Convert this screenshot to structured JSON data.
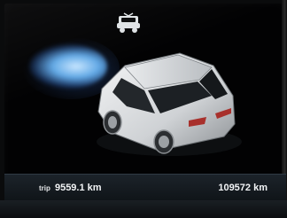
{
  "top_icon": {
    "name": "vehicle-status-icon"
  },
  "vehicle": {
    "name": "car-icon",
    "color": "#e8eaec"
  },
  "glow": {
    "color": "#62a9e6"
  },
  "status_bar": {
    "trip_label": "trip",
    "trip_value": "9559.1 km",
    "odometer_value": "109572 km"
  }
}
